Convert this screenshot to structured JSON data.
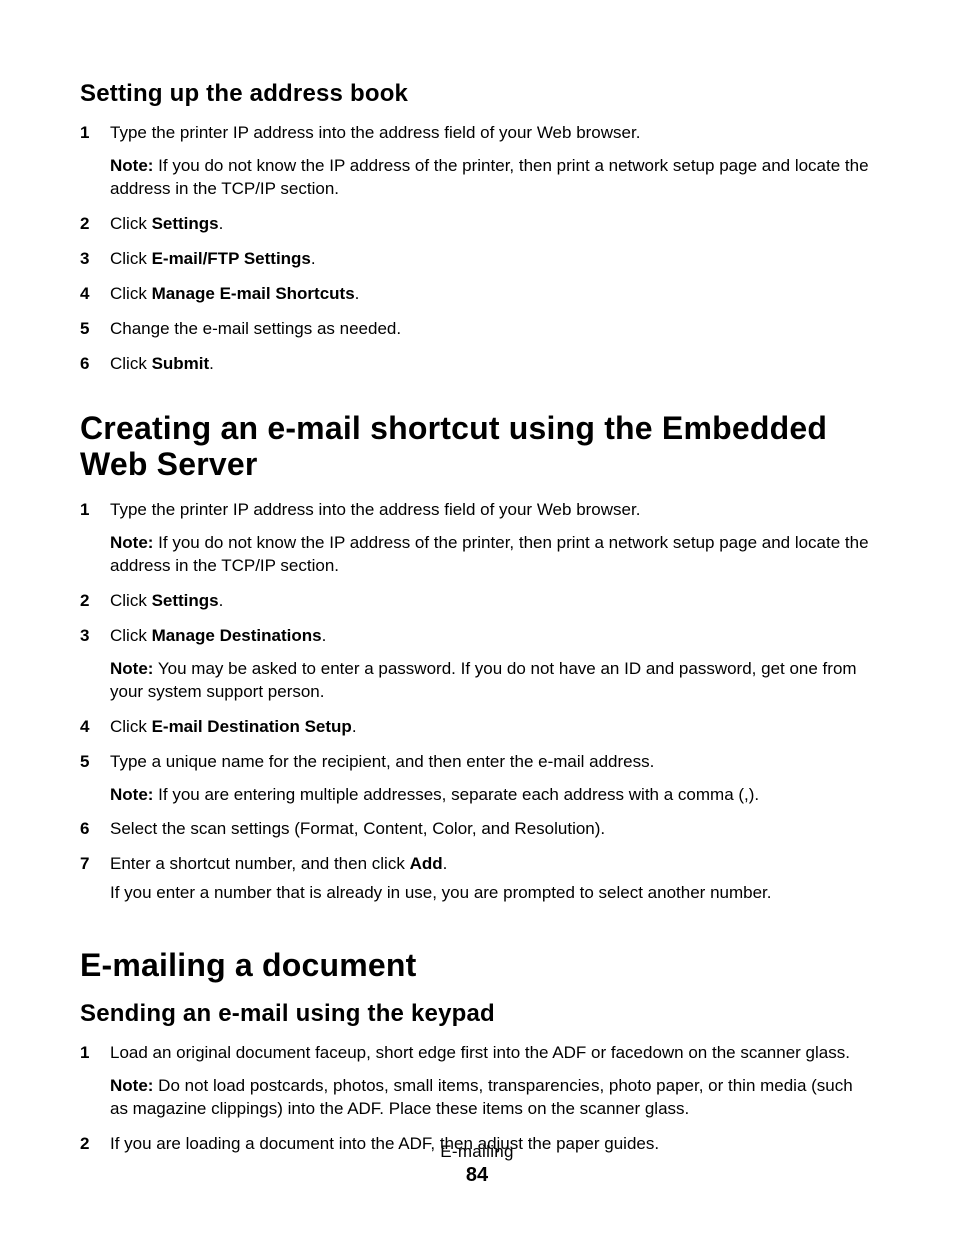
{
  "s1": {
    "title": "Setting up the address book",
    "steps": {
      "n1": "1",
      "t1": "Type the printer IP address into the address field of your Web browser.",
      "note1_lbl": "Note:",
      "note1": " If you do not know the IP address of the printer, then print a network setup page and locate the address in the TCP/IP section.",
      "n2": "2",
      "t2a": "Click ",
      "t2b": "Settings",
      "t2c": ".",
      "n3": "3",
      "t3a": "Click ",
      "t3b": "E-mail/FTP Settings",
      "t3c": ".",
      "n4": "4",
      "t4a": "Click ",
      "t4b": "Manage E-mail Shortcuts",
      "t4c": ".",
      "n5": "5",
      "t5": "Change the e-mail settings as needed.",
      "n6": "6",
      "t6a": "Click ",
      "t6b": "Submit",
      "t6c": "."
    }
  },
  "s2": {
    "title": "Creating an e-mail shortcut using the Embedded Web Server",
    "steps": {
      "n1": "1",
      "t1": "Type the printer IP address into the address field of your Web browser.",
      "note1_lbl": "Note:",
      "note1": " If you do not know the IP address of the printer, then print a network setup page and locate the address in the TCP/IP section.",
      "n2": "2",
      "t2a": "Click ",
      "t2b": "Settings",
      "t2c": ".",
      "n3": "3",
      "t3a": "Click ",
      "t3b": "Manage Destinations",
      "t3c": ".",
      "note3_lbl": "Note:",
      "note3": " You may be asked to enter a password. If you do not have an ID and password, get one from your system support person.",
      "n4": "4",
      "t4a": "Click ",
      "t4b": "E-mail Destination Setup",
      "t4c": ".",
      "n5": "5",
      "t5": "Type a unique name for the recipient, and then enter the e-mail address.",
      "note5_lbl": "Note:",
      "note5": " If you are entering multiple addresses, separate each address with a comma (,).",
      "n6": "6",
      "t6": "Select the scan settings (Format, Content, Color, and Resolution).",
      "n7": "7",
      "t7a": "Enter a shortcut number, and then click ",
      "t7b": "Add",
      "t7c": ".",
      "sub7": "If you enter a number that is already in use, you are prompted to select another number."
    }
  },
  "s3": {
    "title": "E-mailing a document",
    "sub_title": "Sending an e-mail using the keypad",
    "steps": {
      "n1": "1",
      "t1": "Load an original document faceup, short edge first into the ADF or facedown on the scanner glass.",
      "note1_lbl": "Note:",
      "note1": " Do not load postcards, photos, small items, transparencies, photo paper, or thin media (such as magazine clippings) into the ADF. Place these items on the scanner glass.",
      "n2": "2",
      "t2": "If you are loading a document into the ADF, then adjust the paper guides."
    }
  },
  "footer": {
    "title": "E-mailing",
    "page": "84"
  }
}
